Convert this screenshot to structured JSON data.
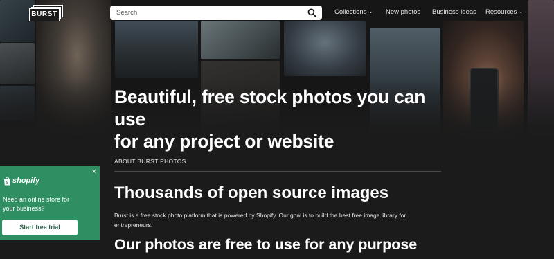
{
  "header": {
    "logo_text": "BURST",
    "search_placeholder": "Search",
    "nav": {
      "collections": "Collections",
      "new_photos": "New photos",
      "business_ideas": "Business ideas",
      "resources": "Resources"
    }
  },
  "hero": {
    "title_line1": "Beautiful, free stock photos you can use",
    "title_line2": "for any project or website"
  },
  "content": {
    "about_label": "ABOUT BURST PHOTOS",
    "heading_1": "Thousands of open source images",
    "paragraph": "Burst is a free stock photo platform that is powered by Shopify. Our goal is to build the best free image library for entrepreneurs.",
    "heading_2": "Our photos are free to use for any purpose"
  },
  "promo": {
    "brand": "shopify",
    "message": "Need an online store for your business?",
    "cta_label": "Start free trial",
    "close_glyph": "×",
    "accent_color": "#2f8f62"
  }
}
